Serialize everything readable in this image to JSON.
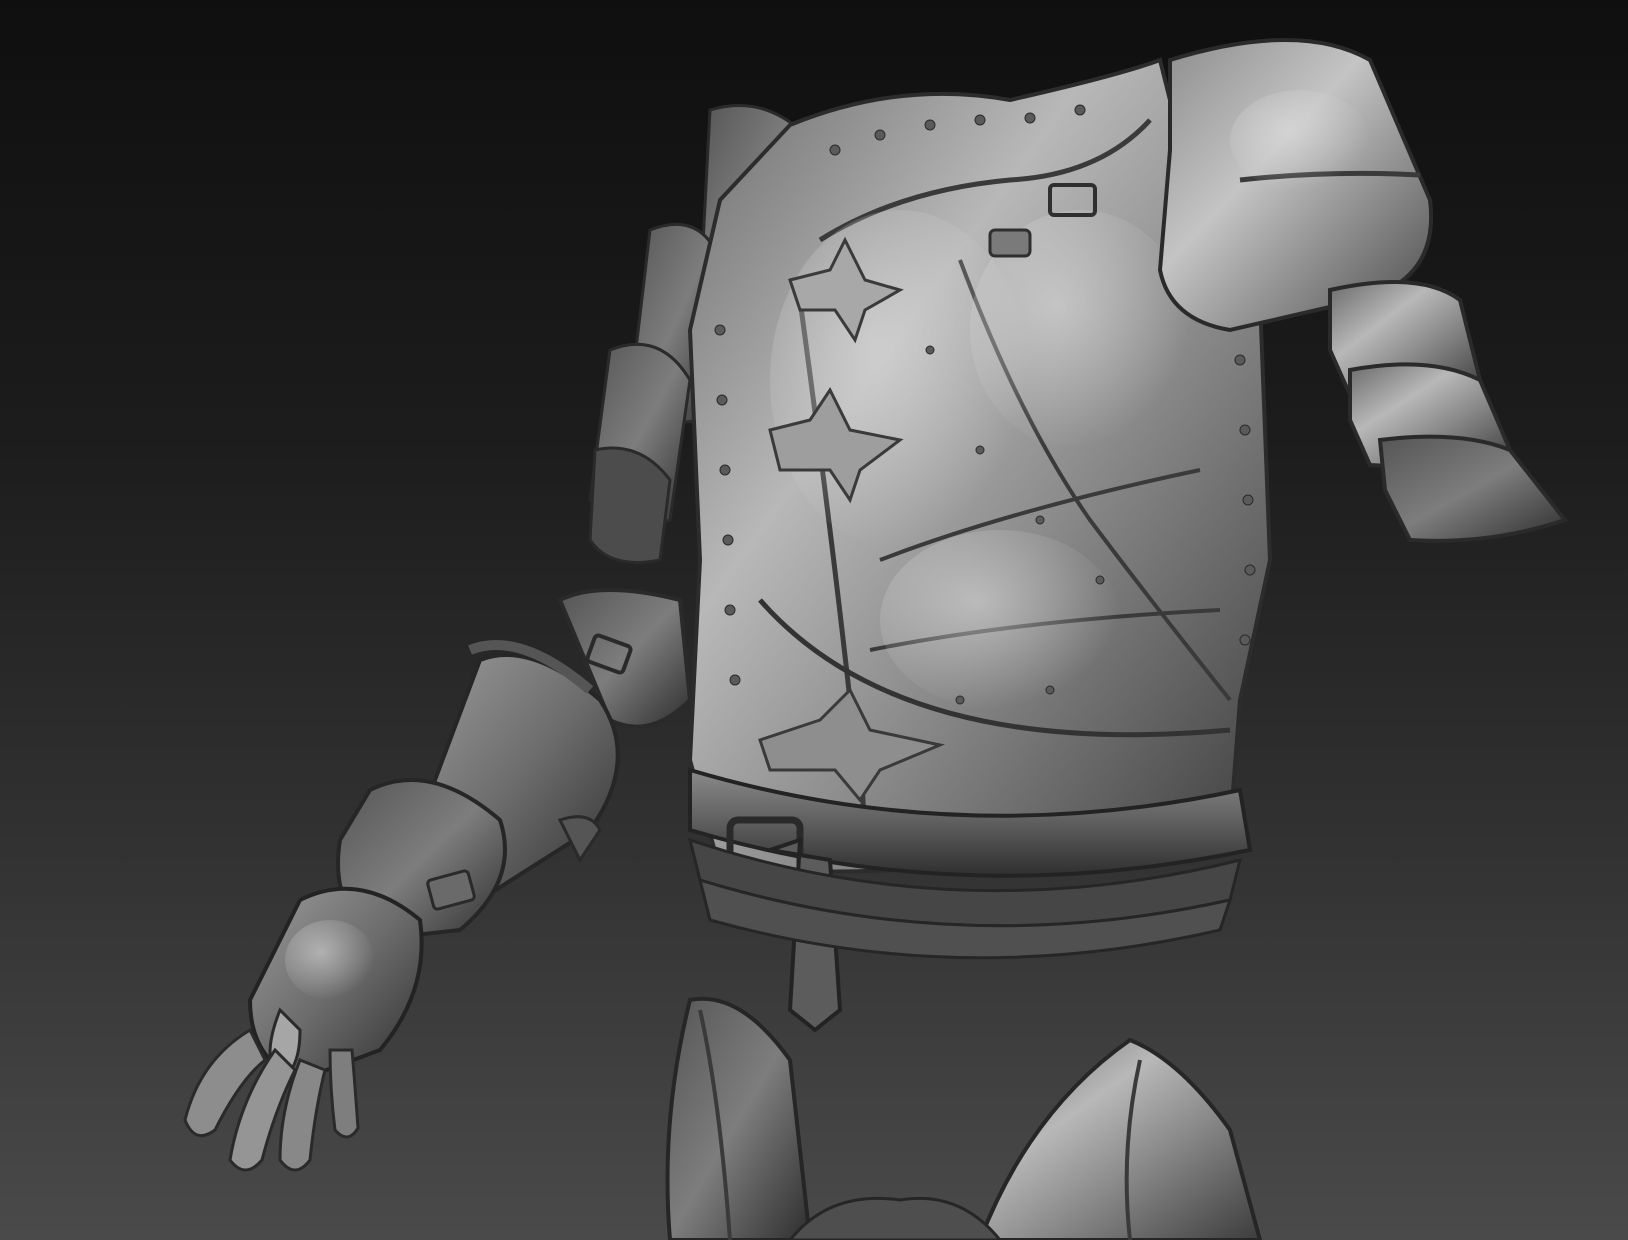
{
  "scene": {
    "subject": "sculpted-armor-render",
    "colors": {
      "background_top": "#0f0f0f",
      "background_bottom": "#4a4a4a",
      "metal_light": "#bdbdbd",
      "metal_mid": "#7a7a7a",
      "metal_dark": "#3a3a3a"
    }
  }
}
